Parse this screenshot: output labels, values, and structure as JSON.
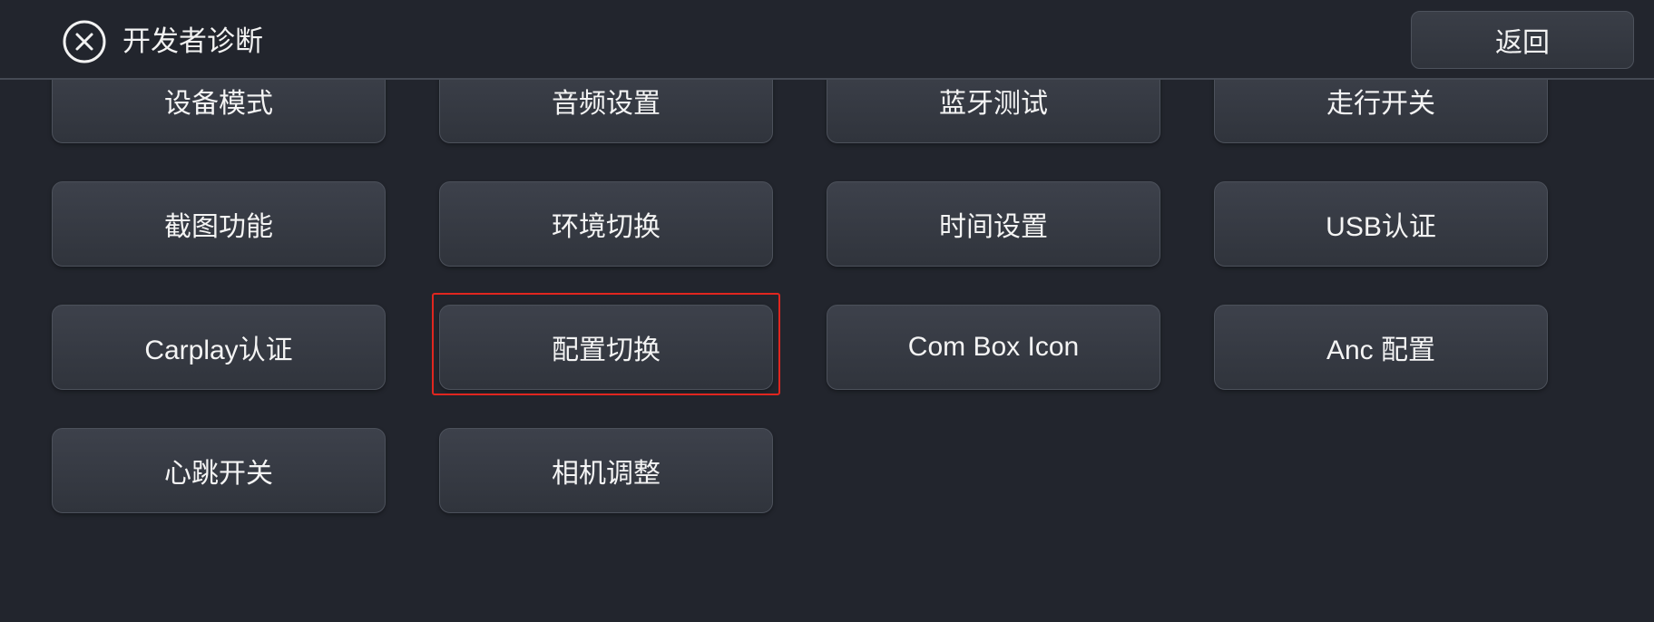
{
  "header": {
    "title": "开发者诊断",
    "back_label": "返回"
  },
  "rows": [
    [
      "设备模式",
      "音频设置",
      "蓝牙测试",
      "走行开关"
    ],
    [
      "截图功能",
      "环境切换",
      "时间设置",
      "USB认证"
    ],
    [
      "Carplay认证",
      "配置切换",
      "Com Box Icon",
      "Anc 配置"
    ],
    [
      "心跳开关",
      "相机调整"
    ]
  ],
  "selected": "配置切换",
  "colors": {
    "background": "#22252d",
    "tile": "#353942",
    "highlight": "#e0261f"
  }
}
